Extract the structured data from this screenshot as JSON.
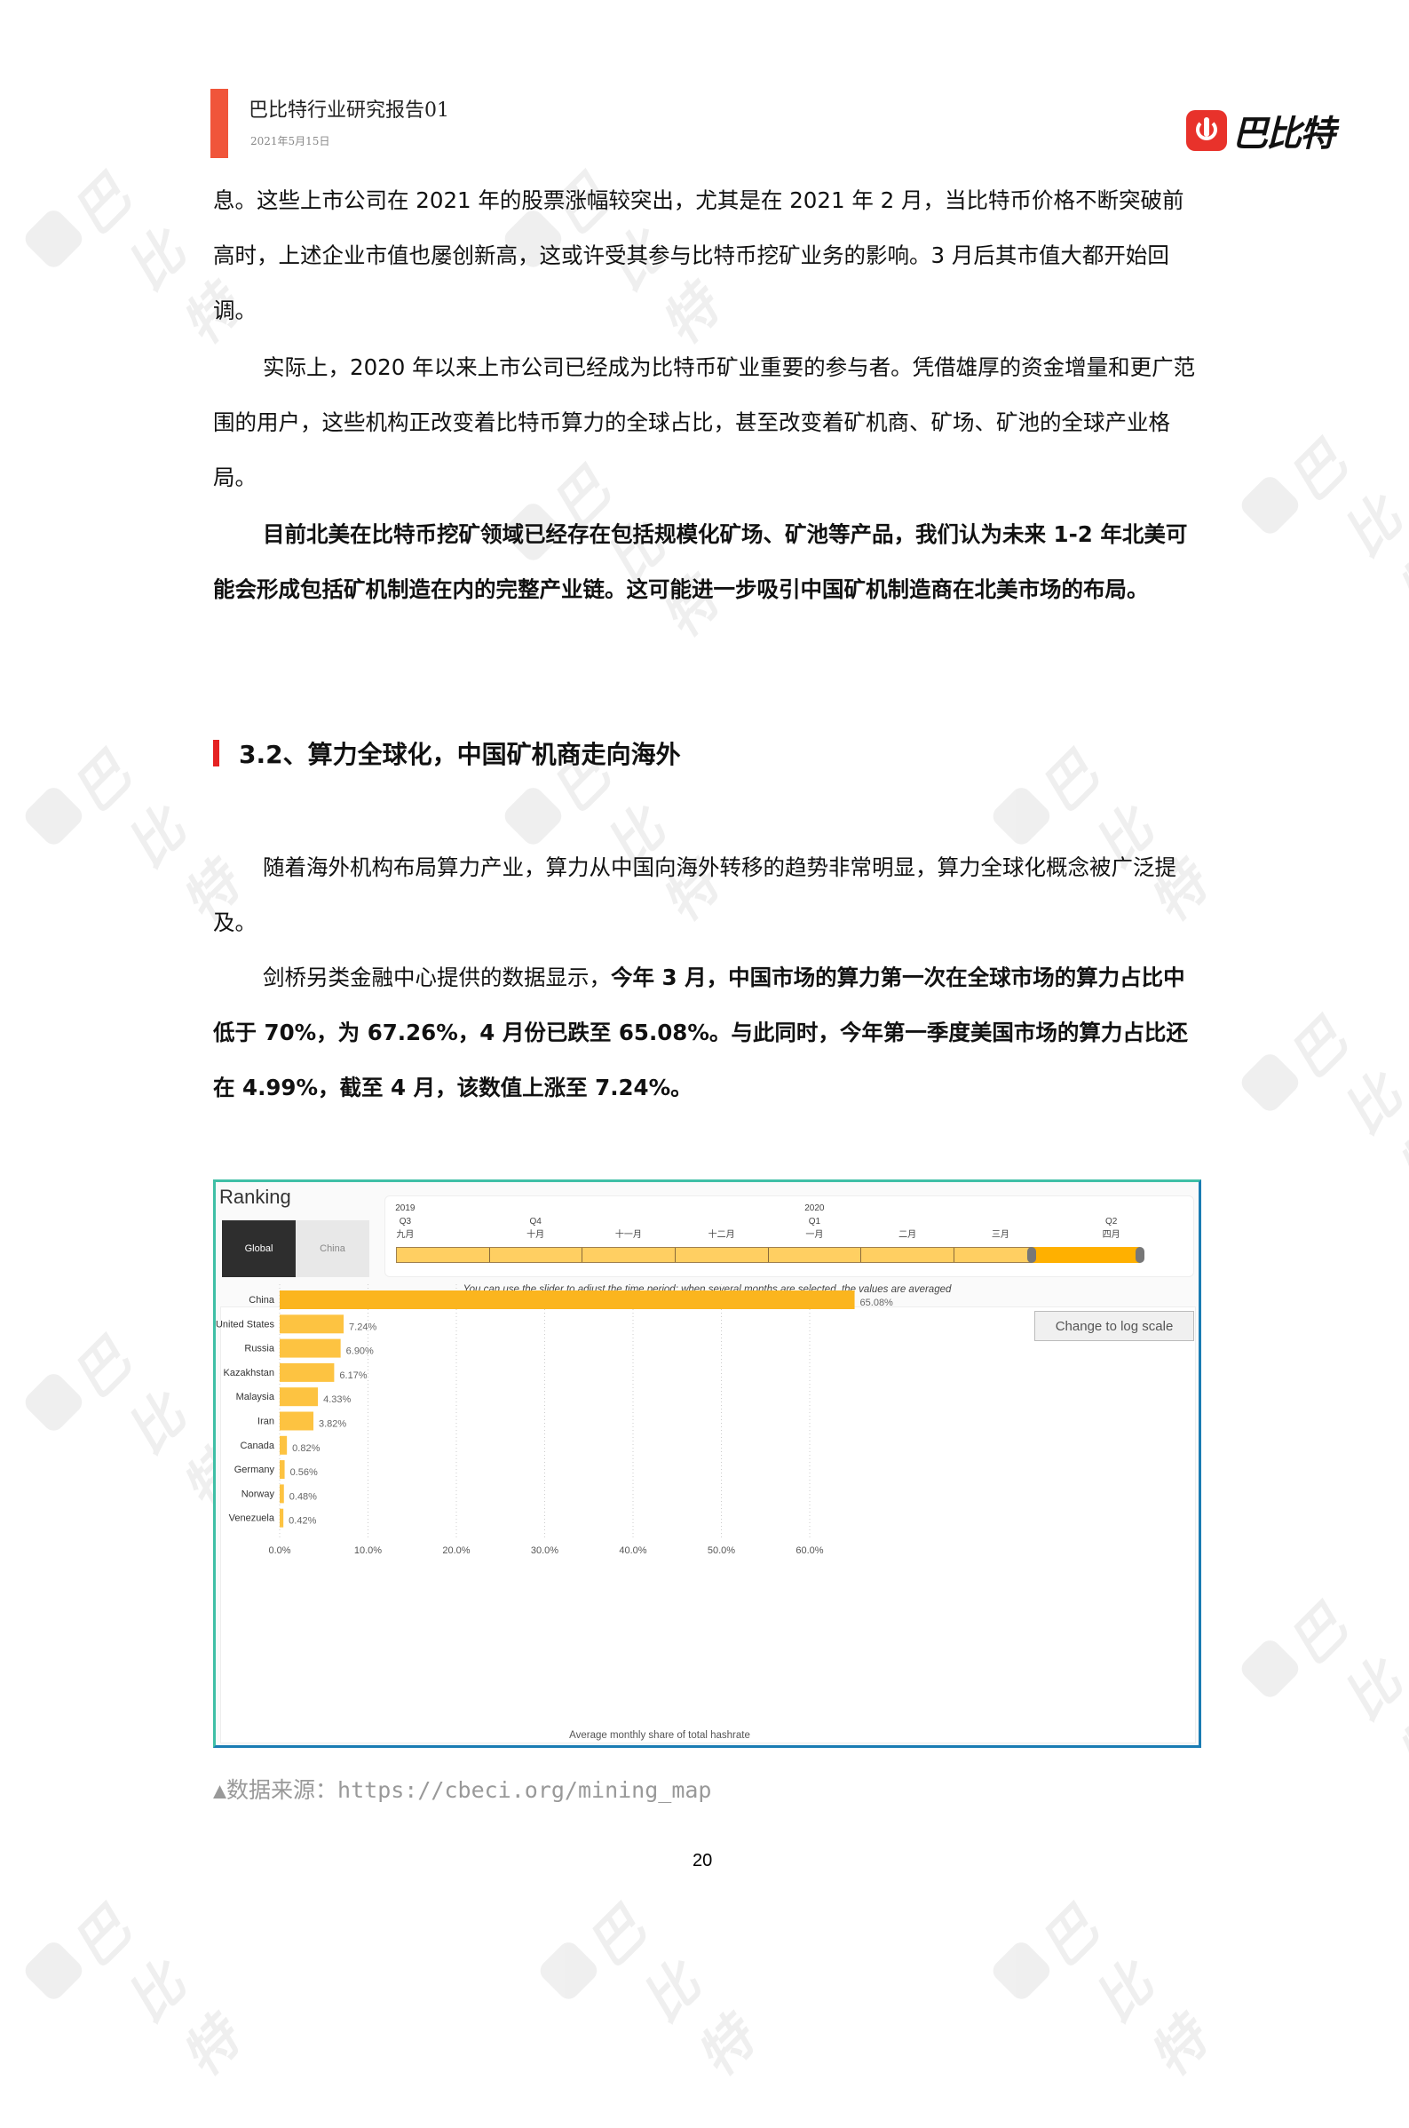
{
  "header": {
    "title": "巴比特行业研究报告01",
    "date": "2021年5月15日",
    "logo_text": "巴比特",
    "accent_color": "#f0553a",
    "logo_color": "#e8322b"
  },
  "watermark": {
    "text": "巴比特"
  },
  "paragraphs": [
    {
      "indent": false,
      "bold": false,
      "text": "息。这些上市公司在 2021 年的股票涨幅较突出，尤其是在 2021 年 2 月，当比特币价格不断突破前高时，上述企业市值也屡创新高，这或许受其参与比特币挖矿业务的影响。3 月后其市值大都开始回调。"
    },
    {
      "indent": true,
      "bold": false,
      "text": "实际上，2020 年以来上市公司已经成为比特币矿业重要的参与者。凭借雄厚的资金增量和更广范围的用户，这些机构正改变着比特币算力的全球占比，甚至改变着矿机商、矿场、矿池的全球产业格局。"
    },
    {
      "indent": true,
      "bold": true,
      "text": "目前北美在比特币挖矿领域已经存在包括规模化矿场、矿池等产品，我们认为未来 1-2 年北美可能会形成包括矿机制造在内的完整产业链。这可能进一步吸引中国矿机制造商在北美市场的布局。"
    }
  ],
  "section": {
    "number": "3.2、",
    "title": "算力全球化，中国矿机商走向海外",
    "marker_color": "#e52222"
  },
  "paragraphs2": {
    "p1": "随着海外机构布局算力产业，算力从中国向海外转移的趋势非常明显，算力全球化概念被广泛提及。",
    "p2_normal": "剑桥另类金融中心提供的数据显示，",
    "p2_bold": "今年 3 月，中国市场的算力第一次在全球市场的算力占比中低于 70%，为 67.26%，4 月份已跌至 65.08%。与此同时，今年第一季度美国市场的算力占比还在 4.99%，截至 4 月，该数值上涨至 7.24%。"
  },
  "widget": {
    "title": "Ranking",
    "tabs": [
      {
        "label": "Global",
        "active": true
      },
      {
        "label": "China",
        "active": false
      }
    ],
    "timeline": [
      {
        "year": "2019",
        "quarter": "Q3",
        "month": "九月"
      },
      {
        "year": "",
        "quarter": "Q4",
        "month": "十月"
      },
      {
        "year": "",
        "quarter": "",
        "month": "十一月"
      },
      {
        "year": "",
        "quarter": "",
        "month": "十二月"
      },
      {
        "year": "2020",
        "quarter": "Q1",
        "month": "一月"
      },
      {
        "year": "",
        "quarter": "",
        "month": "二月"
      },
      {
        "year": "",
        "quarter": "",
        "month": "三月"
      },
      {
        "year": "",
        "quarter": "Q2",
        "month": "四月"
      }
    ],
    "selected_month": "四月",
    "hint": "You can use the slider to adjust the time period: when several months are selected, the values are averaged",
    "log_button": "Change to log scale",
    "frame_color": "#1a7cb3"
  },
  "chart_data": {
    "type": "bar",
    "orientation": "horizontal",
    "categories": [
      "China",
      "United States",
      "Russia",
      "Kazakhstan",
      "Malaysia",
      "Iran",
      "Canada",
      "Germany",
      "Norway",
      "Venezuela"
    ],
    "values": [
      65.08,
      7.24,
      6.9,
      6.17,
      4.33,
      3.82,
      0.82,
      0.56,
      0.48,
      0.42
    ],
    "data_labels": [
      "65.08%",
      "7.24%",
      "6.90%",
      "6.17%",
      "4.33%",
      "3.82%",
      "0.82%",
      "0.56%",
      "0.48%",
      "0.42%"
    ],
    "xlabel": "Average monthly share of total hashrate",
    "ylabel": "",
    "xticks": [
      "0.0%",
      "10.0%",
      "20.0%",
      "30.0%",
      "40.0%",
      "50.0%",
      "60.0%"
    ],
    "xlim": [
      0,
      70
    ],
    "grid": "vertical-dotted",
    "bar_colors": {
      "top": "#fbb51e",
      "rest": "#fdc341"
    }
  },
  "source": "▲数据来源：https://cbeci.org/mining_map",
  "page_number": "20"
}
